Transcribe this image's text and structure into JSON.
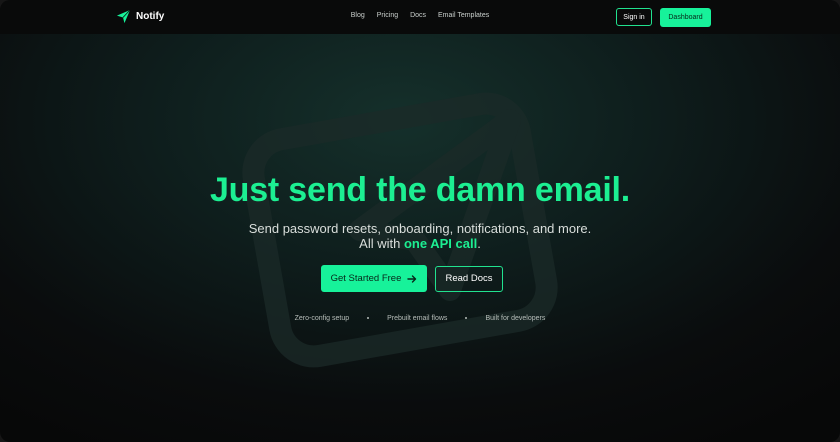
{
  "brand": {
    "name": "Notify",
    "logo_icon": "paper-plane-icon",
    "accent": "#17f29a"
  },
  "nav": {
    "links": [
      {
        "label": "Blog"
      },
      {
        "label": "Pricing"
      },
      {
        "label": "Docs"
      },
      {
        "label": "Email Templates"
      }
    ],
    "signin_label": "Sign in",
    "dashboard_label": "Dashboard"
  },
  "hero": {
    "title": "Just send the damn email.",
    "subtitle_line1": "Send password resets, onboarding, notifications, and more.",
    "subtitle_line2_prefix": "All with ",
    "subtitle_line2_highlight": "one API call",
    "subtitle_line2_suffix": ".",
    "cta_label": "Get Started Free",
    "cta_icon": "arrow-right-icon",
    "docs_label": "Read Docs",
    "background_icon": "paper-plane-icon",
    "features": [
      "Zero-config setup",
      "Prebuilt email flows",
      "Built for developers"
    ]
  }
}
